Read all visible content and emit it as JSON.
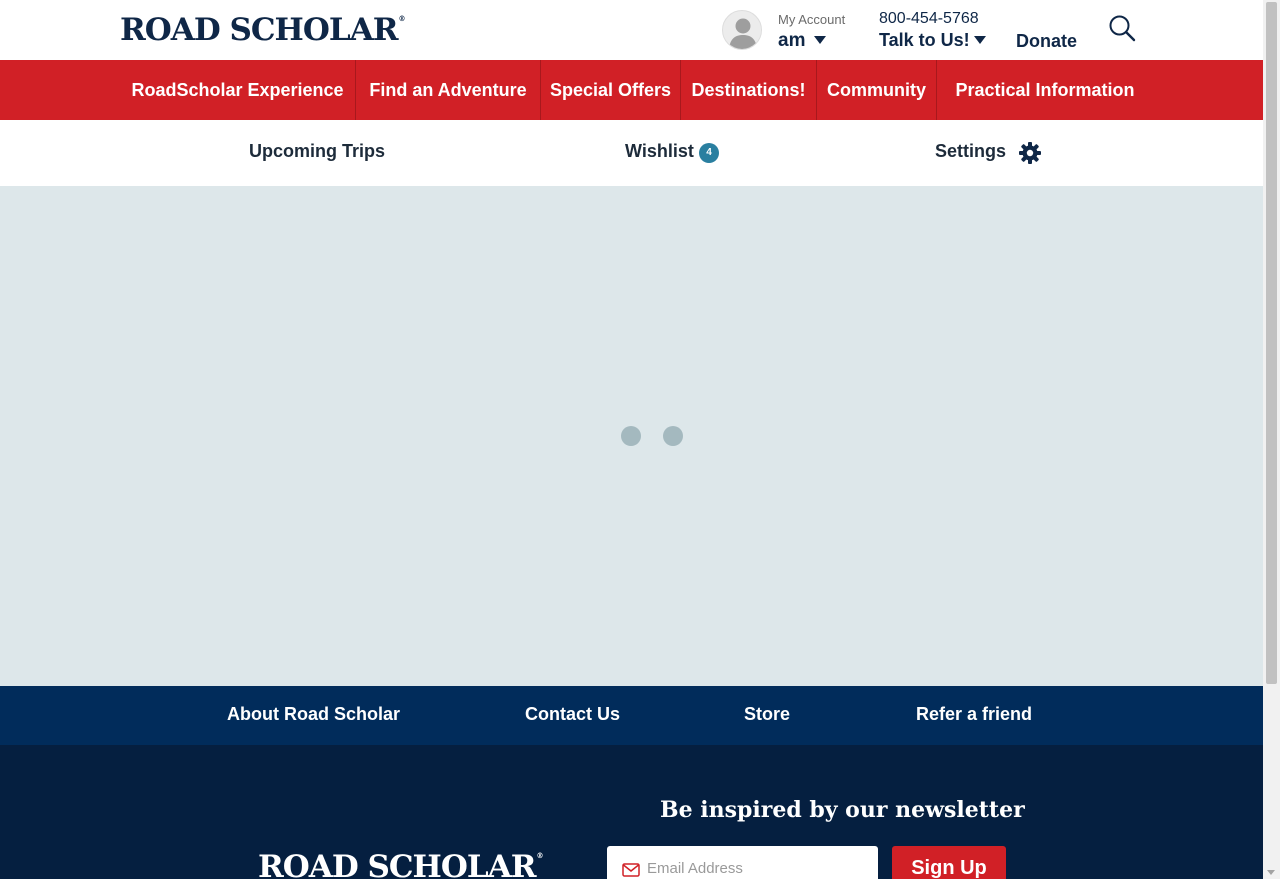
{
  "header": {
    "logo": "ROAD SCHOLAR",
    "logo_mark": "®",
    "account_label": "My Account",
    "account_name": "am",
    "phone": "800-454-5768",
    "talk_label": "Talk to Us!",
    "donate_label": "Donate"
  },
  "main_nav": {
    "items": [
      {
        "label": "RoadScholar Experience"
      },
      {
        "label": "Find an Adventure"
      },
      {
        "label": "Special Offers"
      },
      {
        "label": "Destinations!"
      },
      {
        "label": "Community"
      },
      {
        "label": "Practical Information"
      }
    ]
  },
  "sub_nav": {
    "upcoming": "Upcoming Trips",
    "wishlist": "Wishlist",
    "wishlist_count": "4",
    "settings": "Settings"
  },
  "footer_links": {
    "items": [
      {
        "label": "About Road Scholar"
      },
      {
        "label": "Contact Us"
      },
      {
        "label": "Store"
      },
      {
        "label": "Refer a friend"
      }
    ]
  },
  "footer": {
    "logo": "ROAD SCHOLAR",
    "logo_mark": "®",
    "newsletter_title": "Be inspired by our newsletter",
    "email_placeholder": "Email Address",
    "signup_label": "Sign Up"
  },
  "colors": {
    "brand_red": "#d12026",
    "navy": "#0f2747",
    "footer_blue": "#012c5b",
    "footer_dark": "#051f40",
    "content_bg": "#dde7ea",
    "badge": "#2a7fa0"
  },
  "icons": [
    "avatar-icon",
    "chevron-down-icon",
    "search-icon",
    "gear-icon",
    "mail-icon",
    "loading-dots"
  ]
}
